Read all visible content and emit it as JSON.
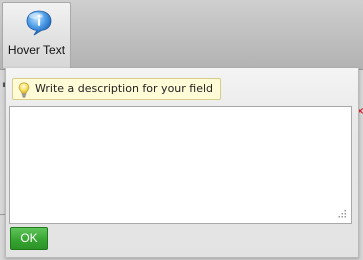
{
  "toolbar": {
    "hover_text_button": {
      "label": "Hover Text",
      "icon": "info-bubble-icon"
    }
  },
  "dialog": {
    "hint_text": "Write a description for your field",
    "hint_icon": "lightbulb-icon",
    "description_value": "",
    "ok_label": "OK"
  },
  "colors": {
    "ok_button": "#35a330",
    "hint_background": "#fffbd6",
    "info_icon": "#2e7fd1"
  }
}
